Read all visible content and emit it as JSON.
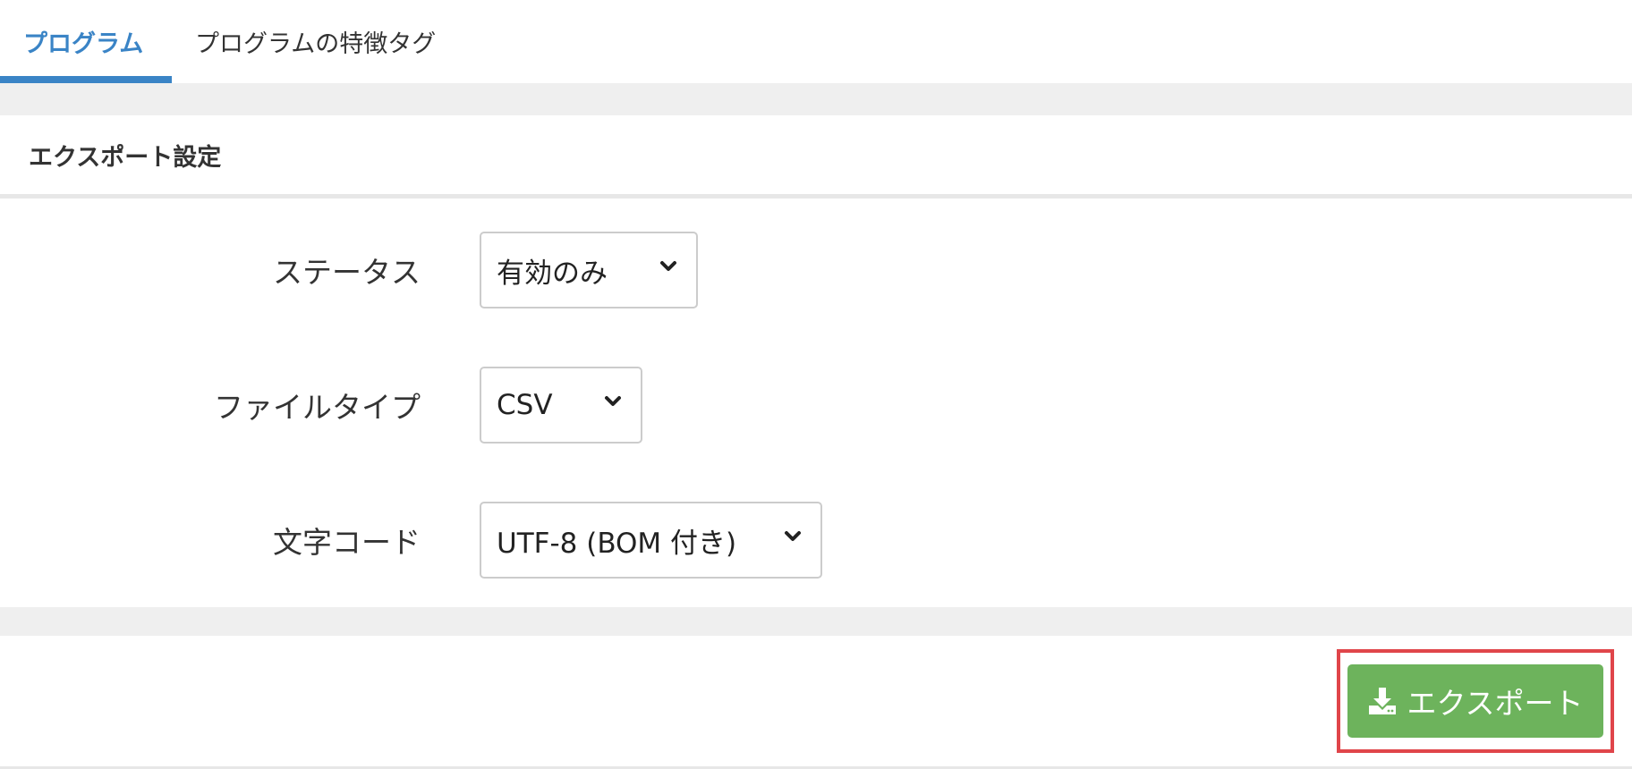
{
  "tabs": [
    {
      "label": "プログラム",
      "active": true
    },
    {
      "label": "プログラムの特徴タグ",
      "active": false
    }
  ],
  "panel": {
    "title": "エクスポート設定"
  },
  "form": {
    "status": {
      "label": "ステータス",
      "value": "有効のみ"
    },
    "file_type": {
      "label": "ファイルタイプ",
      "value": "CSV"
    },
    "charset": {
      "label": "文字コード",
      "value": "UTF-8 (BOM 付き)"
    }
  },
  "footer": {
    "export_label": "エクスポート"
  },
  "icons": {
    "dropdown": "chevron-down-icon",
    "export": "download-icon"
  },
  "colors": {
    "accent": "#3a84c6",
    "button": "#6db35c",
    "highlight": "#e0454a"
  }
}
